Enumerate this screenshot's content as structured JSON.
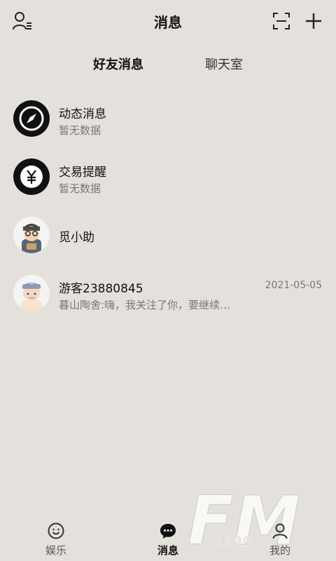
{
  "header": {
    "title": "消息",
    "left_icon": "user-list-icon",
    "right_icons": [
      "scan-icon",
      "plus-icon"
    ]
  },
  "tabs": [
    {
      "label": "好友消息",
      "active": true
    },
    {
      "label": "聊天室",
      "active": false
    }
  ],
  "messages": [
    {
      "name": "动态消息",
      "preview": "暂无数据",
      "date": "",
      "avatar": "compass-icon"
    },
    {
      "name": "交易提醒",
      "preview": "暂无数据",
      "date": "",
      "avatar": "yen-icon"
    },
    {
      "name": "觅小助",
      "preview": "",
      "date": "",
      "avatar": "assistant-avatar"
    },
    {
      "name": "游客23880845",
      "preview": "暮山陶舍:嗨，我关注了你，要继续…",
      "date": "2021-05-05",
      "avatar": "guest-avatar"
    }
  ],
  "bottom_nav": [
    {
      "label": "娱乐",
      "icon": "smile-icon",
      "active": false
    },
    {
      "label": "消息",
      "icon": "chat-bubble-icon",
      "active": true
    },
    {
      "label": "我的",
      "icon": "person-icon",
      "active": false
    }
  ],
  "watermark": {
    "text": "FM",
    "sub": "4399"
  }
}
